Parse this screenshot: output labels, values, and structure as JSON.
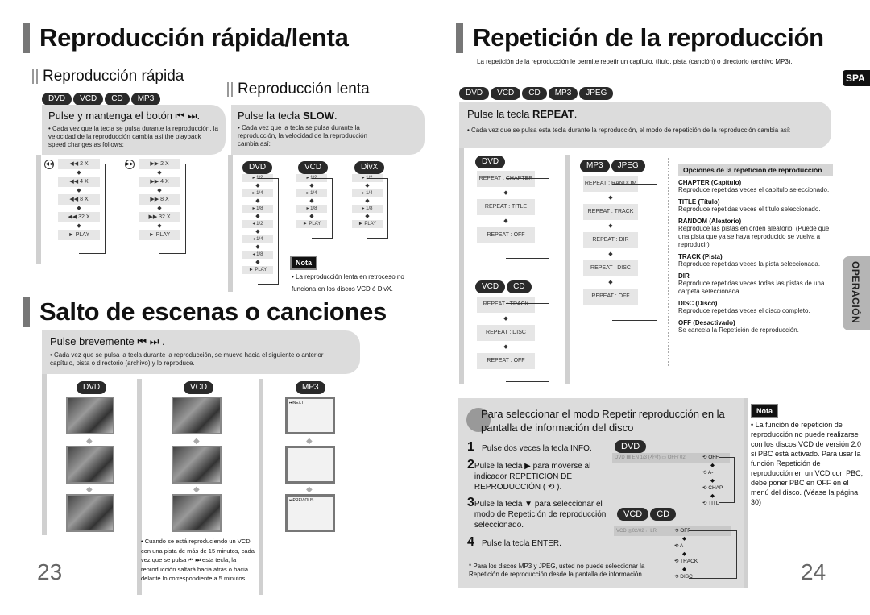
{
  "left_page": {
    "title": "Reproducción rápida/lenta",
    "fast": {
      "heading": "Reproducción rápida",
      "discs": [
        "DVD",
        "VCD",
        "CD",
        "MP3"
      ],
      "instruction": "Pulse y mantenga el botón ⏮ ⏭.",
      "note": "• Cada vez que la tecla se pulsa  durante la reproducción, la velocidad de la reproducción cambia asi:the playback speed changes as follows:",
      "rev_steps": [
        "◀◀  2 X",
        "◀◀  4 X",
        "◀◀  8 X",
        "◀◀  32 X",
        "►  PLAY"
      ],
      "fwd_steps": [
        "▶▶  2 X",
        "▶▶  4 X",
        "▶▶  8 X",
        "▶▶  32 X",
        "►  PLAY"
      ]
    },
    "slow": {
      "heading": "Reproducción lenta",
      "instruction_pre": "Pulse la tecla ",
      "instruction_key": "SLOW",
      "note": "• Cada vez que la tecla se pulsa  durante la reproducción, la velocidad de la reproducción cambia así:",
      "dvd_label": "DVD",
      "vcd_label": "VCD",
      "divx_label": "DivX",
      "dvd_steps": [
        "▸  1/2",
        "▸  1/4",
        "▸  1/8",
        "◂  1/2",
        "◂  1/4",
        "◂  1/8",
        "►  PLAY"
      ],
      "vcd_steps": [
        "▸  1/2",
        "▸  1/4",
        "▸  1/8",
        "►  PLAY"
      ],
      "divx_steps": [
        "▸  1/2",
        "▸  1/4",
        "▸  1/8",
        "►  PLAY"
      ],
      "nota_label": "Nota",
      "nota_text": "• La reproducción lenta en retroceso no funciona en los discos VCD ó DivX."
    },
    "skip": {
      "title": "Salto de escenas o canciones",
      "instruction": "Pulse brevemente ⏮ ⏭  .",
      "note": "• Cada vez que se pulsa la tecla durante la reproducción, se mueve hacia el siguiente o anterior capítulo, pista o directorio (archivo) y lo reproduce.",
      "dvd_label": "DVD",
      "vcd_label": "VCD",
      "mp3_label": "MP3",
      "mp3_next": "⏭NEXT",
      "mp3_prev": "⏮PREVIOUS",
      "vcd_note": "• Cuando se está reproduciendo un VCD con una pista de más de 15 minutos, cada vez que se pulsa ⏮ ⏭ esta tecla, la reproducción saltará hacia atrás o hacia delante lo correspondiente a 5 minutos."
    },
    "page_number": "23"
  },
  "right_page": {
    "title": "Repetición de la reproducción",
    "subtitle": "La repetición de la reproducción le permite repetir un capítulo, título, pista (canción) o directorio (archivo MP3).",
    "discs": [
      "DVD",
      "VCD",
      "CD",
      "MP3",
      "JPEG"
    ],
    "instruction_pre": "Pulse la tecla ",
    "instruction_key": "REPEAT",
    "note": "• Cada vez que se pulsa esta tecla durante la reproducción, el modo de repetición de la reproducción cambia así:",
    "dvd_label": "DVD",
    "dvd_steps": [
      "REPEAT : CHAPTER",
      "REPEAT : TITLE",
      "REPEAT : OFF"
    ],
    "vcdcd_labels": [
      "VCD",
      "CD"
    ],
    "vcdcd_steps": [
      "REPEAT : TRACK",
      "REPEAT : DISC",
      "REPEAT : OFF"
    ],
    "mp3jpeg_labels": [
      "MP3",
      "JPEG"
    ],
    "mp3jpeg_steps": [
      "REPEAT : RANDOM",
      "REPEAT : TRACK",
      "REPEAT : DIR",
      "REPEAT : DISC",
      "REPEAT : OFF"
    ],
    "options": {
      "title": "Opciones de la repetición de reproducción",
      "items": [
        {
          "name": "CHAPTER (Capítulo)",
          "desc": "Reproduce repetidas veces el capítulo seleccionado."
        },
        {
          "name": "TITLE (Título)",
          "desc": "Reproduce repetidas veces el título seleccionado."
        },
        {
          "name": "RANDOM (Aleatorio)",
          "desc": "Reproduce las pistas en orden aleatorio. (Puede que una pista que ya se haya reproducido se vuelva a reproducir)"
        },
        {
          "name": "TRACK (Pista)",
          "desc": "Reproduce repetidas veces la pista seleccionada."
        },
        {
          "name": "DIR",
          "desc": "Reproduce repetidas veces todas las pistas de una carpeta seleccionada."
        },
        {
          "name": "DISC (Disco)",
          "desc": "Reproduce repetidas veces el disco completo."
        },
        {
          "name": "OFF (Desactivado)",
          "desc": "Se cancela la Repetición de reproducción."
        }
      ]
    },
    "info_box": {
      "title": "Para seleccionar el modo Repetir reproducción en la pantalla de información del disco",
      "steps": [
        {
          "num": "1",
          "text": "Pulse dos veces la tecla INFO."
        },
        {
          "num": "2",
          "text": "Pulse la tecla ▶  para  moverse al indicador REPETICIÓN DE REPRODUCCIÓN ( ⟲ )."
        },
        {
          "num": "3",
          "text": "Pulse la tecla ▼  para seleccionar el modo de Repetición de reproducción seleccionado."
        },
        {
          "num": "4",
          "text": "Pulse la tecla ENTER."
        }
      ],
      "footnote": "* Para los discos MP3 y JPEG, usted no puede seleccionar la Repetición de reproducción desde la pantalla de información.",
      "dvd_label": "DVD",
      "dvd_bar": "DVD  ▦ EN 1/3  (자막)   ▭ OFF/ 02",
      "dvd_modes": [
        "⟲ OFF",
        "⟲ A-",
        "⟲ CHAP",
        "⟲ TITL"
      ],
      "vcd_labels": [
        "VCD",
        "CD"
      ],
      "vcd_bar": "VCD  ◎02/02   ∩ LR",
      "vcd_modes": [
        "⟲ OFF",
        "⟲ A-",
        "⟲ TRACK",
        "⟲ DISC"
      ]
    },
    "nota_label": "Nota",
    "nota_text": "• La función de repetición de reproducción no puede realizarse con los discos VCD de versión 2.0 si PBC está activado. Para usar la función Repetición de reproducción en un VCD con PBC, debe poner PBC en OFF en el menú del disco. (Véase la página 30)",
    "page_number": "24",
    "side_tab_lang": "SPA",
    "side_tab_section": "OPERACIÓN"
  }
}
